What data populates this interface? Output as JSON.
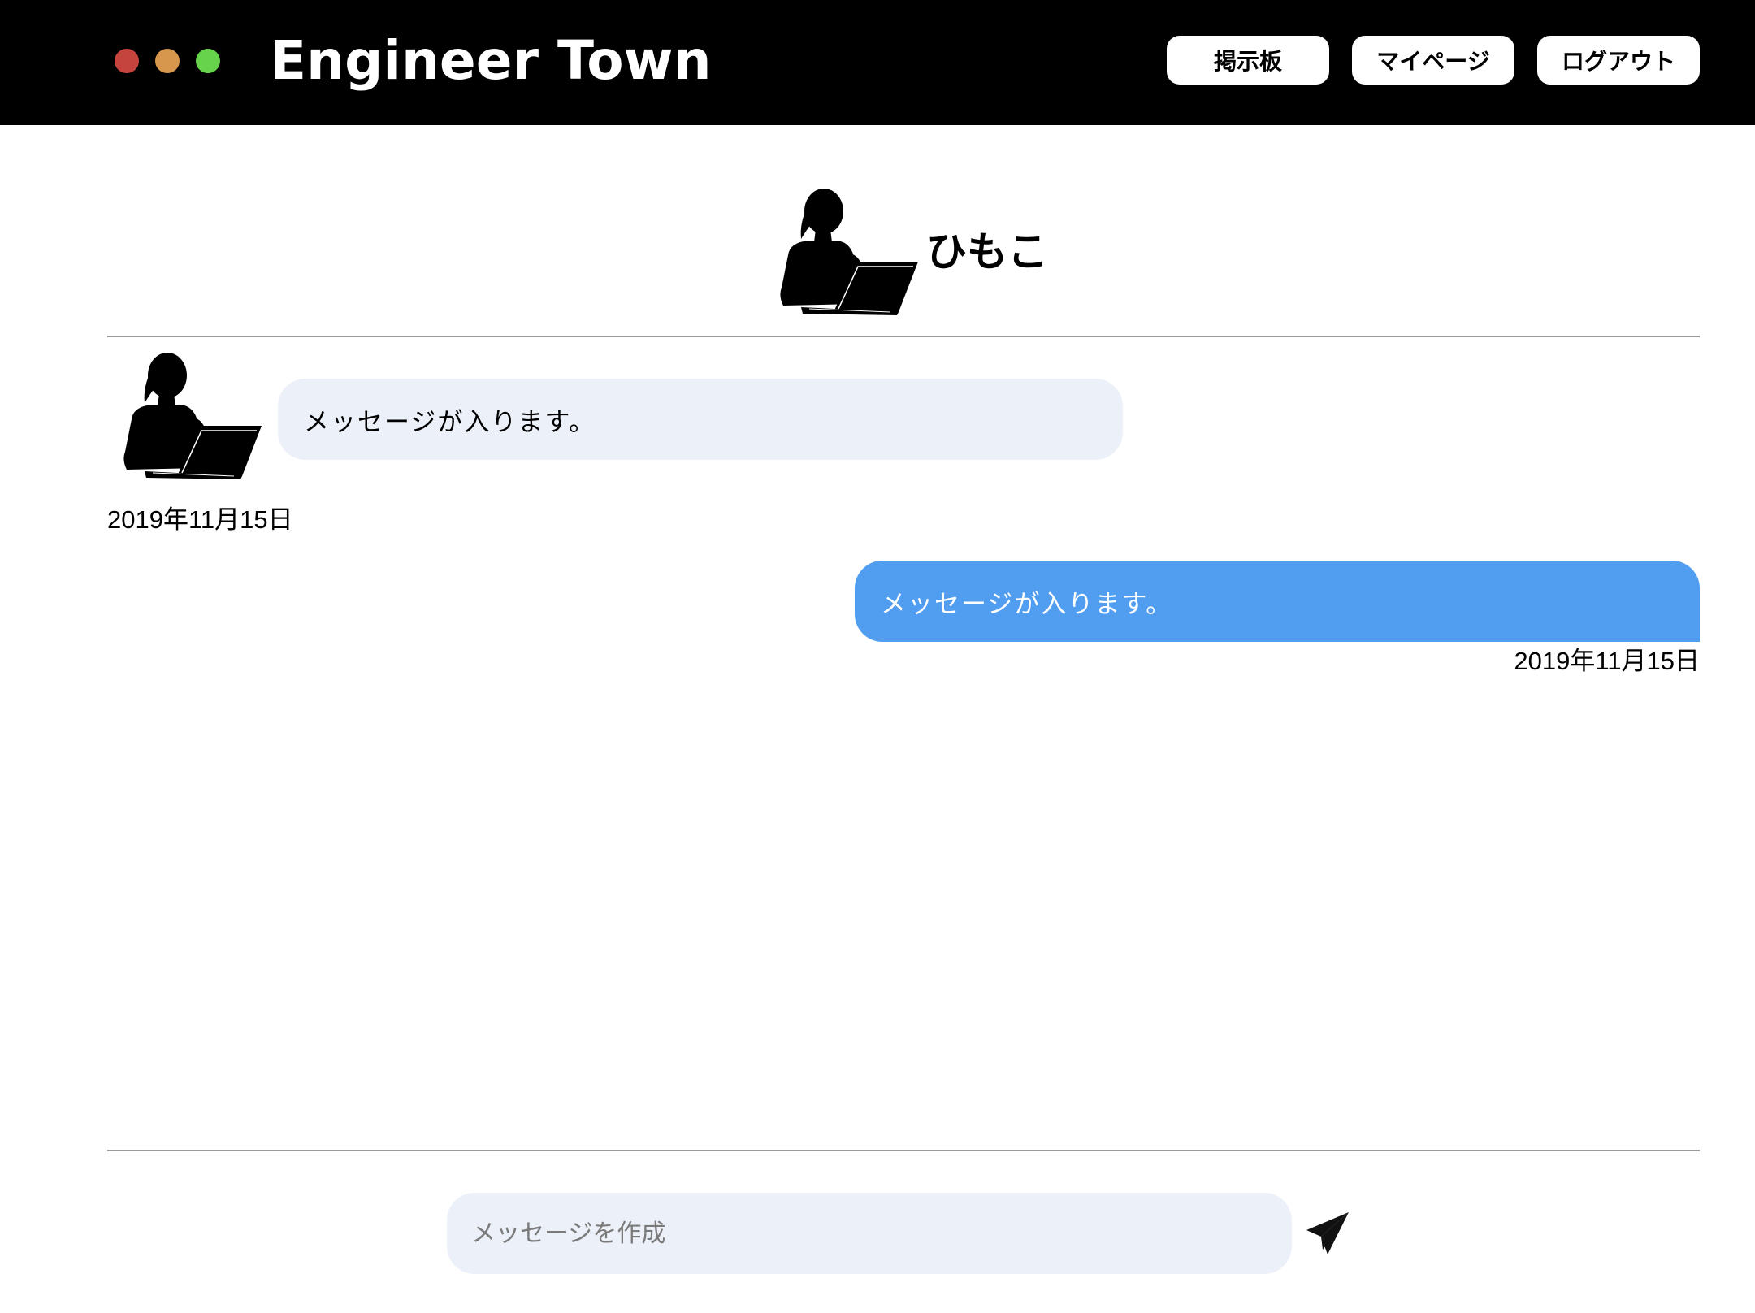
{
  "window": {
    "controls": [
      "close",
      "minimize",
      "maximize"
    ],
    "colors": {
      "close": "#c5443e",
      "minimize": "#d7974c",
      "maximize": "#67d34b"
    }
  },
  "header": {
    "title": "Engineer Town",
    "nav": {
      "board_label": "掲示板",
      "mypage_label": "マイページ",
      "logout_label": "ログアウト"
    }
  },
  "partner": {
    "name": "ひもこ",
    "avatar_icon": "woman-with-laptop-silhouette-icon"
  },
  "messages": [
    {
      "direction": "received",
      "text": "メッセージが入ります。",
      "date": "2019年11月15日"
    },
    {
      "direction": "sent",
      "text": "メッセージが入ります。",
      "date": "2019年11月15日"
    }
  ],
  "composer": {
    "placeholder": "メッセージを作成",
    "value": "",
    "send_icon": "paper-plane-icon"
  },
  "colors": {
    "header_bg": "#000000",
    "received_bubble": "#ecf0f8",
    "sent_bubble": "#519ef0",
    "divider": "#9a9a9a"
  }
}
